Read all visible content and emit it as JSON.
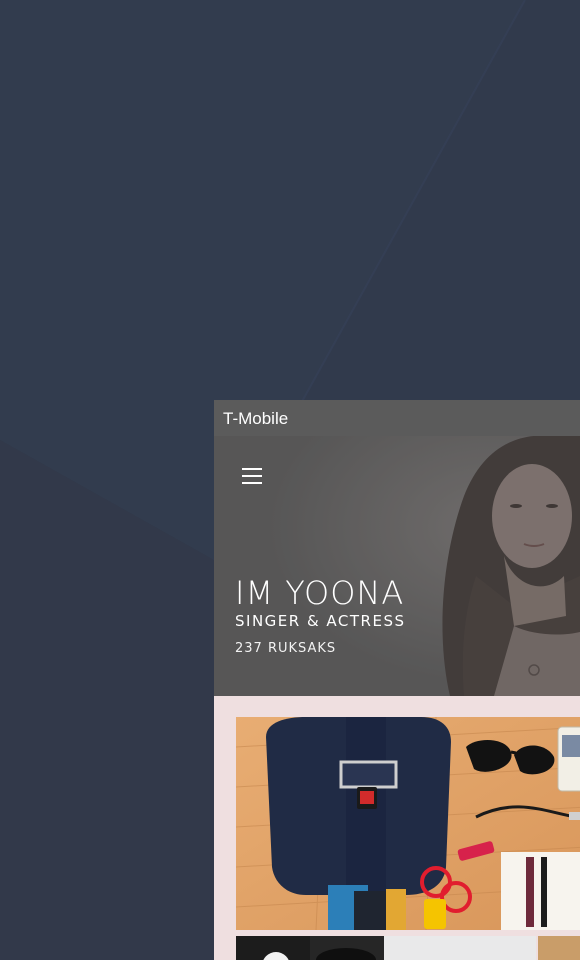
{
  "status_bar": {
    "carrier": "T-Mobile"
  },
  "profile": {
    "name": "IM YOONA",
    "role": "SINGER & ACTRESS",
    "count": "237 RUKSAKS"
  },
  "colors": {
    "background": "#333b4c",
    "status_bar": "#5b5b5b",
    "hero_overlay": "#5f5e5e",
    "content_bg": "#efdfe0"
  },
  "icons": {
    "menu": "hamburger-menu-icon"
  }
}
